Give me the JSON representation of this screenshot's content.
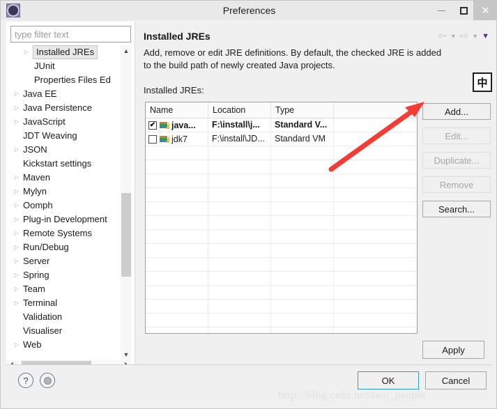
{
  "window": {
    "title": "Preferences",
    "app_icon": "eclipse-icon",
    "minimize": "minimize-icon",
    "maximize": "maximize-icon",
    "close": "close-icon"
  },
  "sidebar": {
    "filter_placeholder": "type filter text",
    "filter_value": "",
    "items": [
      {
        "label": "Installed JREs",
        "level": 1,
        "expandable": true,
        "selected": true
      },
      {
        "label": "JUnit",
        "level": 1,
        "expandable": false,
        "selected": false
      },
      {
        "label": "Properties Files Ed",
        "level": 1,
        "expandable": false,
        "selected": false
      },
      {
        "label": "Java EE",
        "level": 0,
        "expandable": true,
        "selected": false
      },
      {
        "label": "Java Persistence",
        "level": 0,
        "expandable": true,
        "selected": false
      },
      {
        "label": "JavaScript",
        "level": 0,
        "expandable": true,
        "selected": false
      },
      {
        "label": "JDT Weaving",
        "level": 0,
        "expandable": false,
        "selected": false
      },
      {
        "label": "JSON",
        "level": 0,
        "expandable": true,
        "selected": false
      },
      {
        "label": "Kickstart settings",
        "level": 0,
        "expandable": false,
        "selected": false
      },
      {
        "label": "Maven",
        "level": 0,
        "expandable": true,
        "selected": false
      },
      {
        "label": "Mylyn",
        "level": 0,
        "expandable": true,
        "selected": false
      },
      {
        "label": "Oomph",
        "level": 0,
        "expandable": true,
        "selected": false
      },
      {
        "label": "Plug-in Development",
        "level": 0,
        "expandable": true,
        "selected": false
      },
      {
        "label": "Remote Systems",
        "level": 0,
        "expandable": true,
        "selected": false
      },
      {
        "label": "Run/Debug",
        "level": 0,
        "expandable": true,
        "selected": false
      },
      {
        "label": "Server",
        "level": 0,
        "expandable": true,
        "selected": false
      },
      {
        "label": "Spring",
        "level": 0,
        "expandable": true,
        "selected": false
      },
      {
        "label": "Team",
        "level": 0,
        "expandable": true,
        "selected": false
      },
      {
        "label": "Terminal",
        "level": 0,
        "expandable": true,
        "selected": false
      },
      {
        "label": "Validation",
        "level": 0,
        "expandable": false,
        "selected": false
      },
      {
        "label": "Visualiser",
        "level": 0,
        "expandable": false,
        "selected": false
      },
      {
        "label": "Web",
        "level": 0,
        "expandable": true,
        "selected": false
      }
    ],
    "scroll_up_icon": "chevron-up-icon",
    "scroll_down_icon": "chevron-down-icon",
    "scroll_left_icon": "chevron-left-icon",
    "scroll_right_icon": "chevron-right-icon"
  },
  "page": {
    "title": "Installed JREs",
    "description": "Add, remove or edit JRE definitions. By default, the checked JRE is added to the build path of newly created Java projects.",
    "list_label": "Installed JREs:",
    "nav": {
      "back_icon": "back-arrow-icon",
      "back_menu_icon": "chevron-down-icon",
      "forward_icon": "forward-arrow-icon",
      "forward_menu_icon": "chevron-down-icon",
      "view_menu_icon": "chevron-down-icon",
      "accent_color": "#5b2d86"
    }
  },
  "ime_indicator": {
    "label": "中"
  },
  "table": {
    "columns": [
      "Name",
      "Location",
      "Type"
    ],
    "rows": [
      {
        "checked": true,
        "name": "java...",
        "location": "F:\\install\\j...",
        "type": "Standard V...",
        "bold": true
      },
      {
        "checked": false,
        "name": "jdk7",
        "location": "F:\\install\\JD...",
        "type": "Standard VM",
        "bold": false
      }
    ],
    "empty_row_count": 14,
    "row_icon": "jre-library-icon"
  },
  "side_buttons": [
    {
      "label": "Add...",
      "enabled": true
    },
    {
      "label": "Edit...",
      "enabled": false
    },
    {
      "label": "Duplicate...",
      "enabled": false
    },
    {
      "label": "Remove",
      "enabled": false
    },
    {
      "label": "Search...",
      "enabled": true
    }
  ],
  "apply_button": {
    "label": "Apply"
  },
  "footer": {
    "help_icon": "question-mark-icon",
    "restore_icon": "restore-defaults-icon",
    "ok_label": "OK",
    "cancel_label": "Cancel"
  },
  "annotation": {
    "arrow_color": "#f23c34",
    "arrow_name": "red-pointer-arrow"
  },
  "watermark": {
    "text": "http://blog.csdn.net/two_people"
  }
}
